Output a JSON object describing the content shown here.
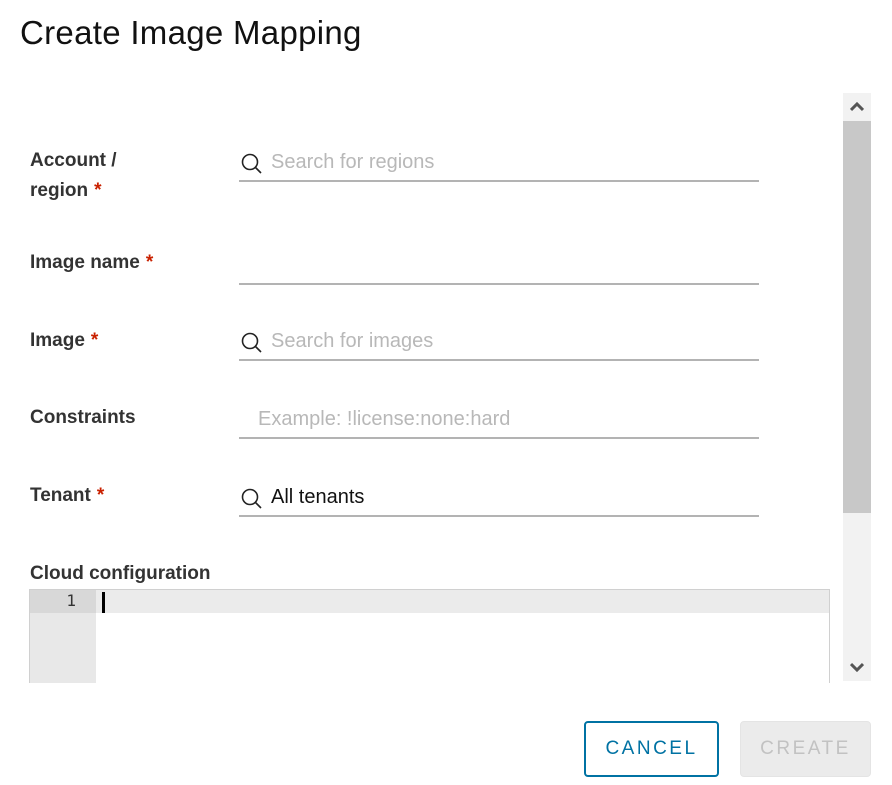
{
  "dialog": {
    "title": "Create Image Mapping"
  },
  "form": {
    "account_region": {
      "label_line1": "Account /",
      "label_line2": "region",
      "required_marker": "*",
      "icon": "search-icon",
      "placeholder": "Search for regions",
      "value": ""
    },
    "image_name": {
      "label": "Image name",
      "required_marker": "*",
      "value": ""
    },
    "image": {
      "label": "Image",
      "required_marker": "*",
      "icon": "search-icon",
      "placeholder": "Search for images",
      "value": ""
    },
    "constraints": {
      "label": "Constraints",
      "placeholder": "Example: !license:none:hard",
      "value": ""
    },
    "tenant": {
      "label": "Tenant",
      "required_marker": "*",
      "icon": "search-icon",
      "value": "All tenants"
    },
    "cloud_configuration": {
      "label": "Cloud configuration",
      "line_numbers": [
        "1"
      ],
      "content": ""
    }
  },
  "scrollbar": {
    "up_icon": "chevron-up-icon",
    "down_icon": "chevron-down-icon"
  },
  "footer": {
    "cancel_label": "CANCEL",
    "create_label": "CREATE",
    "create_disabled": true
  },
  "colors": {
    "primary": "#0072a3",
    "required": "#c92100",
    "disabled_bg": "#ebebeb",
    "disabled_text": "#c2c2c2"
  }
}
